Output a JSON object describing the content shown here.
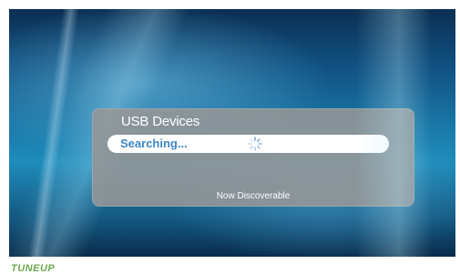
{
  "dialog": {
    "title": "USB Devices",
    "search_status": "Searching...",
    "footer_status": "Now Discoverable"
  },
  "brand": {
    "logo_text": "TUNEUP",
    "color": "#6aa84f"
  },
  "icons": {
    "spinner": "loading-spinner-icon"
  },
  "colors": {
    "dialog_bg": "#969696",
    "search_text": "#3d86c6",
    "background": "#1a79a9"
  }
}
